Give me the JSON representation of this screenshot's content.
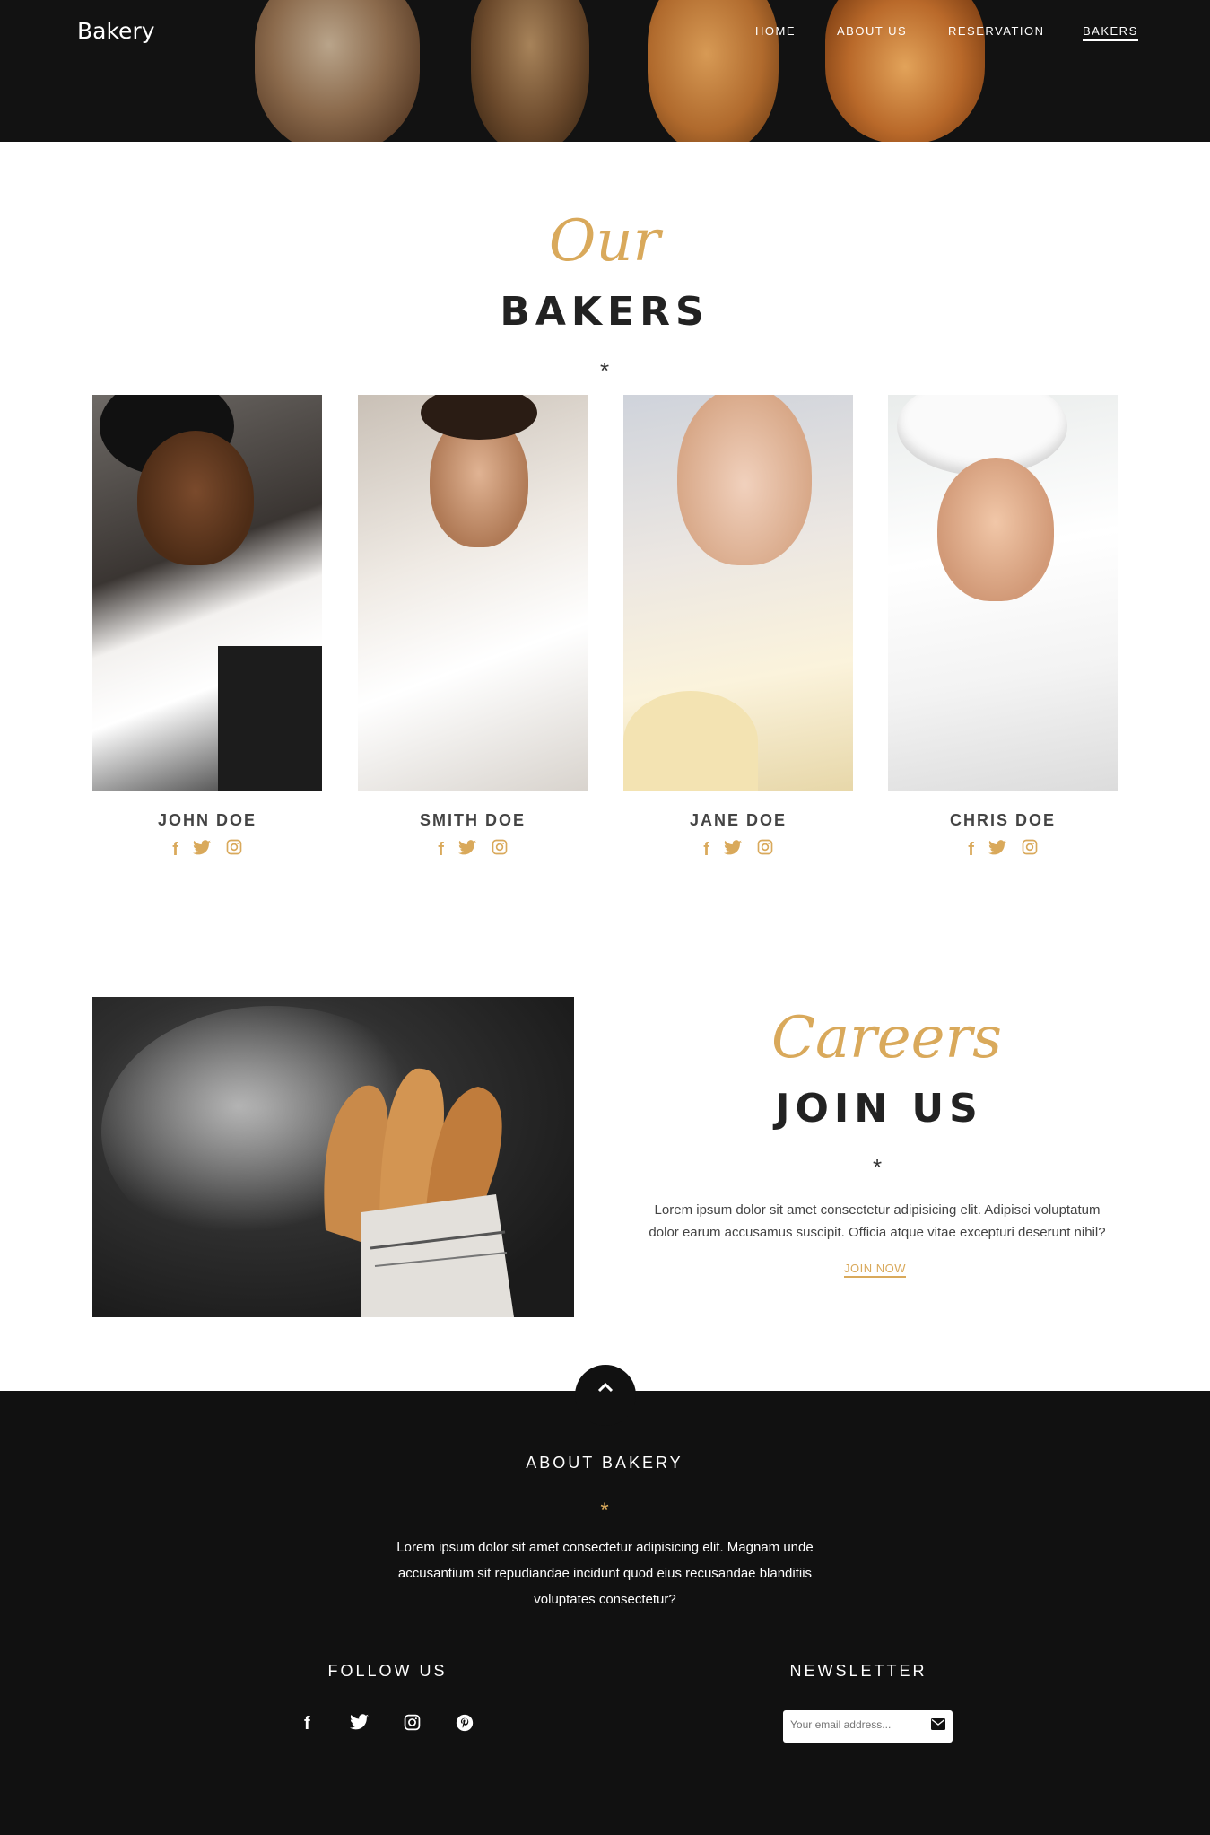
{
  "header": {
    "logo": "Bakery",
    "nav": [
      {
        "label": "HOME"
      },
      {
        "label": "ABOUT US"
      },
      {
        "label": "RESERVATION"
      },
      {
        "label": "BAKERS",
        "active": true
      }
    ]
  },
  "bakers_section": {
    "script_title": "Our",
    "title": "BAKERS",
    "divider": "*",
    "bakers": [
      {
        "name": "JOHN DOE"
      },
      {
        "name": "SMITH DOE"
      },
      {
        "name": "JANE DOE"
      },
      {
        "name": "CHRIS DOE"
      }
    ],
    "social_icons": [
      "facebook-icon",
      "twitter-icon",
      "instagram-icon"
    ]
  },
  "careers": {
    "script_title": "Careers",
    "title": "JOIN US",
    "divider": "*",
    "text": "Lorem ipsum dolor sit amet consectetur adipisicing elit. Adipisci voluptatum dolor earum accusamus suscipit. Officia atque vitae excepturi deserunt nihil?",
    "link": "JOIN NOW"
  },
  "footer": {
    "about_title": "ABOUT BAKERY",
    "divider": "*",
    "about_text": "Lorem ipsum dolor sit amet consectetur adipisicing elit. Magnam unde accusantium sit repudiandae incidunt quod eius recusandae blanditiis voluptates consectetur?",
    "follow_title": "FOLLOW US",
    "follow_icons": [
      "facebook-icon",
      "twitter-icon",
      "instagram-icon",
      "pinterest-icon"
    ],
    "newsletter_title": "NEWSLETTER",
    "newsletter_placeholder": "Your email address..."
  },
  "colors": {
    "accent": "#d9a95b",
    "dark": "#111111"
  }
}
